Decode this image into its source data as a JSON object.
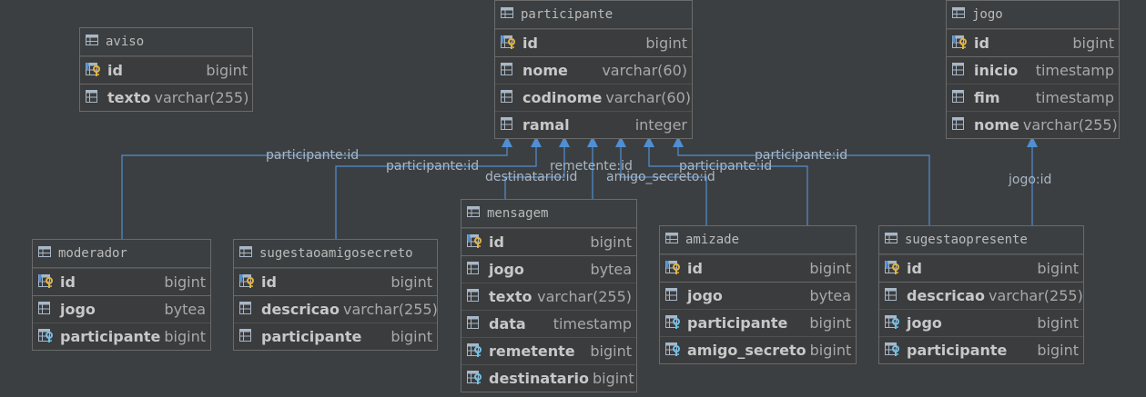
{
  "colors": {
    "background": "#3c3f41",
    "edge": "#4f8fd4",
    "key": "#e2b341",
    "foreign_key": "#6fc1e8"
  },
  "tables": {
    "aviso": {
      "name": "aviso",
      "columns": [
        {
          "name": "id",
          "type": "bigint",
          "icon": "primary-key-icon"
        },
        {
          "name": "texto",
          "type": "varchar(255)",
          "icon": "column-icon"
        }
      ]
    },
    "participante": {
      "name": "participante",
      "columns": [
        {
          "name": "id",
          "type": "bigint",
          "icon": "primary-key-icon"
        },
        {
          "name": "nome",
          "type": "varchar(60)",
          "icon": "column-icon"
        },
        {
          "name": "codinome",
          "type": "varchar(60)",
          "icon": "column-icon"
        },
        {
          "name": "ramal",
          "type": "integer",
          "icon": "column-icon"
        }
      ]
    },
    "jogo": {
      "name": "jogo",
      "columns": [
        {
          "name": "id",
          "type": "bigint",
          "icon": "primary-key-icon"
        },
        {
          "name": "inicio",
          "type": "timestamp",
          "icon": "column-icon"
        },
        {
          "name": "fim",
          "type": "timestamp",
          "icon": "column-icon"
        },
        {
          "name": "nome",
          "type": "varchar(255)",
          "icon": "column-icon"
        }
      ]
    },
    "moderador": {
      "name": "moderador",
      "columns": [
        {
          "name": "id",
          "type": "bigint",
          "icon": "primary-key-icon"
        },
        {
          "name": "jogo",
          "type": "bytea",
          "icon": "column-icon"
        },
        {
          "name": "participante",
          "type": "bigint",
          "icon": "foreign-key-icon"
        }
      ]
    },
    "sugestaoamigosecreto": {
      "name": "sugestaoamigosecreto",
      "columns": [
        {
          "name": "id",
          "type": "bigint",
          "icon": "primary-key-icon"
        },
        {
          "name": "descricao",
          "type": "varchar(255)",
          "icon": "column-icon"
        },
        {
          "name": "participante",
          "type": "bigint",
          "icon": "column-icon"
        }
      ]
    },
    "mensagem": {
      "name": "mensagem",
      "columns": [
        {
          "name": "id",
          "type": "bigint",
          "icon": "primary-key-icon"
        },
        {
          "name": "jogo",
          "type": "bytea",
          "icon": "column-icon"
        },
        {
          "name": "texto",
          "type": "varchar(255)",
          "icon": "column-icon"
        },
        {
          "name": "data",
          "type": "timestamp",
          "icon": "column-icon"
        },
        {
          "name": "remetente",
          "type": "bigint",
          "icon": "foreign-key-icon"
        },
        {
          "name": "destinatario",
          "type": "bigint",
          "icon": "foreign-key-icon"
        }
      ]
    },
    "amizade": {
      "name": "amizade",
      "columns": [
        {
          "name": "id",
          "type": "bigint",
          "icon": "primary-key-icon"
        },
        {
          "name": "jogo",
          "type": "bytea",
          "icon": "column-icon"
        },
        {
          "name": "participante",
          "type": "bigint",
          "icon": "foreign-key-icon"
        },
        {
          "name": "amigo_secreto",
          "type": "bigint",
          "icon": "foreign-key-icon"
        }
      ]
    },
    "sugestaopresente": {
      "name": "sugestaopresente",
      "columns": [
        {
          "name": "id",
          "type": "bigint",
          "icon": "primary-key-icon"
        },
        {
          "name": "descricao",
          "type": "varchar(255)",
          "icon": "column-icon"
        },
        {
          "name": "jogo",
          "type": "bigint",
          "icon": "foreign-key-icon"
        },
        {
          "name": "participante",
          "type": "bigint",
          "icon": "foreign-key-icon"
        }
      ]
    }
  },
  "relations": [
    {
      "label": "participante:id",
      "from": "moderador",
      "to": "participante"
    },
    {
      "label": "participante:id",
      "from": "sugestaoamigosecreto",
      "to": "participante"
    },
    {
      "label": "destinatario:id",
      "from": "mensagem",
      "to": "participante"
    },
    {
      "label": "remetente:id",
      "from": "mensagem",
      "to": "participante"
    },
    {
      "label": "amigo_secreto:id",
      "from": "amizade",
      "to": "participante"
    },
    {
      "label": "participante:id",
      "from": "amizade",
      "to": "participante"
    },
    {
      "label": "participante:id",
      "from": "sugestaopresente",
      "to": "participante"
    },
    {
      "label": "jogo:id",
      "from": "sugestaopresente",
      "to": "jogo"
    }
  ]
}
